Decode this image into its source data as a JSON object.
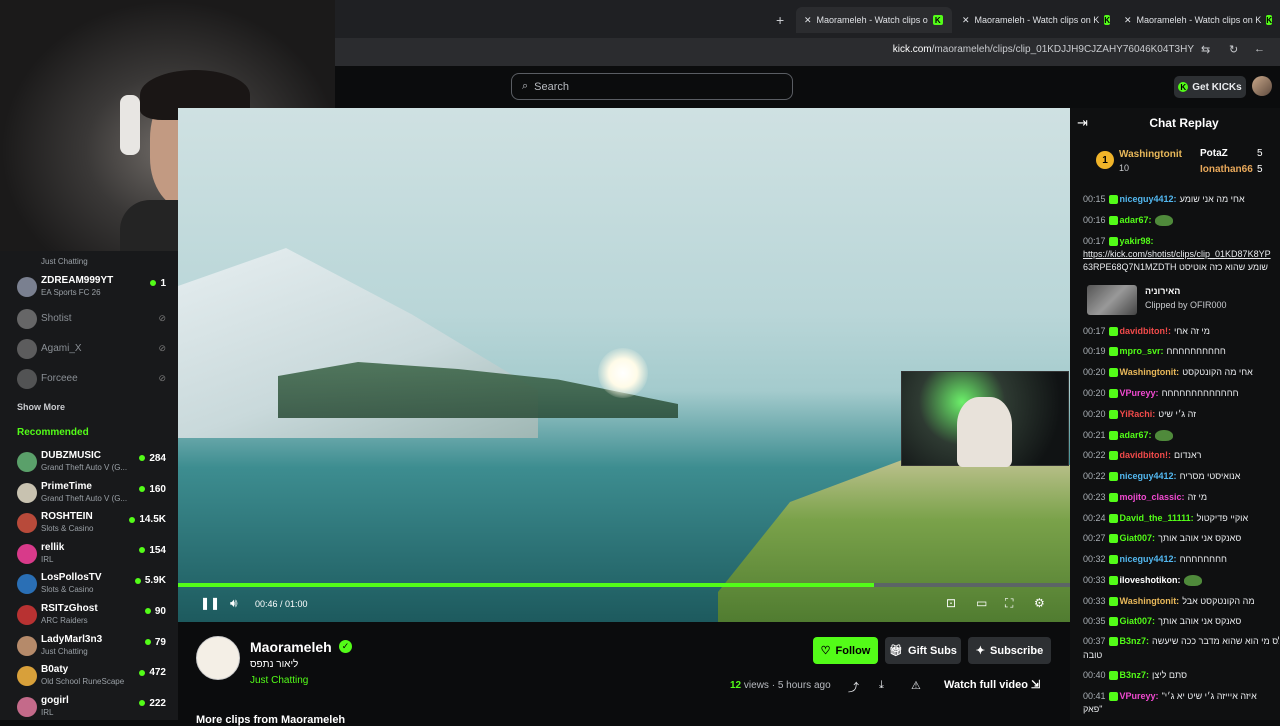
{
  "browser": {
    "tabs": [
      {
        "title": "Maorameleh - Watch clips o"
      },
      {
        "title": "Maorameleh - Watch clips on K"
      },
      {
        "title": "Maorameleh - Watch clips on K"
      }
    ],
    "new_tab": "+",
    "url_domain": "kick.com",
    "url_path": "/maorameleh/clips/clip_01KDJJH9CJZAHY76046K04T3HY"
  },
  "header": {
    "search_placeholder": "Search",
    "get_kicks_label": "Get KICKs"
  },
  "sidebar": {
    "following": [
      {
        "name": "ZDREAM999YT",
        "category": "EA Sports FC 26",
        "viewers": "1",
        "avatar": "#7a8090"
      },
      {
        "name": "Shotist",
        "offline": true,
        "avatar": "#9a9a9a"
      },
      {
        "name": "Agami_X",
        "offline": true,
        "avatar": "#8a8a8a"
      },
      {
        "name": "Forceee",
        "offline": true,
        "avatar": "#7a7a7a"
      }
    ],
    "partial_top": {
      "category": "Just Chatting"
    },
    "show_more": "Show More",
    "recommended_title": "Recommended",
    "recommended": [
      {
        "name": "DUBZMUSIC",
        "category": "Grand Theft Auto V (G...",
        "viewers": "284",
        "avatar": "#5aa06a"
      },
      {
        "name": "PrimeTime",
        "category": "Grand Theft Auto V (G...",
        "viewers": "160",
        "avatar": "#c8c2b0"
      },
      {
        "name": "ROSHTEIN",
        "category": "Slots & Casino",
        "viewers": "14.5K",
        "avatar": "#b84a3a"
      },
      {
        "name": "rellik",
        "category": "IRL",
        "viewers": "154",
        "avatar": "#d83a8a"
      },
      {
        "name": "LosPollosTV",
        "category": "Slots & Casino",
        "viewers": "5.9K",
        "avatar": "#2a6fb5"
      },
      {
        "name": "RSITzGhost",
        "category": "ARC Raiders",
        "viewers": "90",
        "avatar": "#b83232"
      },
      {
        "name": "LadyMarl3n3",
        "category": "Just Chatting",
        "viewers": "79",
        "avatar": "#b58a6a"
      },
      {
        "name": "B0aty",
        "category": "Old School RuneScape",
        "viewers": "472",
        "avatar": "#d8a03a"
      },
      {
        "name": "gogirl",
        "category": "IRL",
        "viewers": "222",
        "avatar": "#c46a8a"
      }
    ]
  },
  "player": {
    "time": "00:46 / 01:00",
    "progress": 0.78
  },
  "channel": {
    "name": "Maorameleh",
    "clip_title": "ליאור נתפס",
    "category": "Just Chatting",
    "follow_label": "Follow",
    "gift_subs_label": "Gift Subs",
    "subscribe_label": "Subscribe",
    "views_count": "12",
    "views_label": "views",
    "time_ago": "5 hours ago",
    "watch_full_label": "Watch full video",
    "more_clips": "More clips from Maorameleh"
  },
  "chat": {
    "title": "Chat Replay",
    "leaderboard": {
      "rank": "1",
      "first": {
        "name": "Washingtonit",
        "count": "10"
      },
      "second": {
        "name": "PotaZ",
        "count": "5"
      },
      "third": {
        "name": "Ionathan66",
        "count": "5"
      }
    },
    "messages": [
      {
        "time": "00:15",
        "user": "niceguy4412:",
        "color": "#53b8f0",
        "text": "אחי מה אני שומע"
      },
      {
        "time": "00:16",
        "user": "adar67:",
        "color": "#53fc18",
        "text": "",
        "emote": true
      },
      {
        "time": "00:17",
        "user": "yakir98:",
        "color": "#53fc18",
        "text": ""
      },
      {
        "time": "",
        "user": "",
        "color": "#fff",
        "text": "https://kick.com/shotist/clips/clip_01KD87K8YP"
      },
      {
        "time": "",
        "user": "",
        "color": "#fff",
        "text": "63RPE68Q7N1MZDTH שומע שהוא כזה אוטיסט"
      },
      {
        "time": "00:17",
        "user": "davidbiton!:",
        "color": "#f04a4a",
        "text": "מי זה אחי"
      },
      {
        "time": "00:19",
        "user": "mpro_svr:",
        "color": "#53fc18",
        "text": "חחחחחחחחחח"
      },
      {
        "time": "00:20",
        "user": "Washingtonit:",
        "color": "#e8b85a",
        "text": "אחי מה הקונטקסט"
      },
      {
        "time": "00:20",
        "user": "VPureyy:",
        "color": "#f04ad0",
        "text": "חחחחחחחחחחחחח"
      },
      {
        "time": "00:20",
        "user": "YiRachi:",
        "color": "#f04a4a",
        "text": "זה ג׳י שיט"
      },
      {
        "time": "00:21",
        "user": "adar67:",
        "color": "#53fc18",
        "text": "",
        "emote": true
      },
      {
        "time": "00:22",
        "user": "davidbiton!:",
        "color": "#f04a4a",
        "text": "ראנדום"
      },
      {
        "time": "00:22",
        "user": "niceguy4412:",
        "color": "#53b8f0",
        "text": "אנואיסטי מסריח"
      },
      {
        "time": "00:23",
        "user": "mojito_classic:",
        "color": "#f04ad0",
        "text": "מי זה"
      },
      {
        "time": "00:24",
        "user": "David_the_11111:",
        "color": "#53fc18",
        "text": "אוקיי פדיקטול"
      },
      {
        "time": "00:27",
        "user": "Giat007:",
        "color": "#53fc18",
        "text": "סאנקס אני אוהב אותך"
      },
      {
        "time": "00:32",
        "user": "niceguy4412:",
        "color": "#53b8f0",
        "text": "חחחחחחחח"
      },
      {
        "time": "00:33",
        "user": "iloveshotikon:",
        "color": "#fff",
        "text": "",
        "emote": true
      },
      {
        "time": "00:33",
        "user": "Washingtonit:",
        "color": "#e8b85a",
        "text": "מה הקונטקסט אבל"
      },
      {
        "time": "00:35",
        "user": "Giat007:",
        "color": "#53fc18",
        "text": "סאנקס אני אוהב אותך"
      },
      {
        "time": "00:37",
        "user": "B3nz7:",
        "color": "#53fc18",
        "text": "בתכלס מי הוא שהוא מדבר ככה שיעשה"
      },
      {
        "time": "",
        "user": "",
        "color": "#fff",
        "text": "טובה"
      },
      {
        "time": "00:40",
        "user": "B3nz7:",
        "color": "#53fc18",
        "text": "סתם ליצן"
      },
      {
        "time": "00:41",
        "user": "VPureyy:",
        "color": "#f04ad0",
        "text": "\"איזה איייזה ג׳י שיט יא ג׳י"
      },
      {
        "time": "",
        "user": "",
        "color": "#fff",
        "text": "פאק\""
      }
    ],
    "clip_card": {
      "title": "האירוניה",
      "clipped_by": "Clipped by OFIR000"
    }
  },
  "icons": {
    "search": "search-icon",
    "pause": "pause-icon",
    "volume": "volume-icon",
    "fullscreen": "fullscreen-icon",
    "share": "share-icon",
    "download": "download-icon",
    "report": "warning-icon"
  },
  "colors": {
    "accent": "#53fc18",
    "background": "#0b0c0d",
    "sidebar": "#18191b"
  }
}
